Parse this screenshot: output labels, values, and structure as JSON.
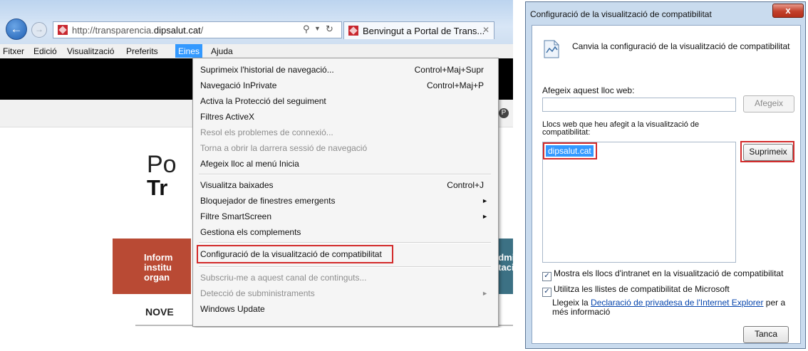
{
  "browser": {
    "address_url_prefix": "http://transparencia.",
    "address_url_domain": "dipsalut.cat",
    "address_url_suffix": "/",
    "tab_title": "Benvingut a Portal de Trans...",
    "menubar": [
      "Fitxer",
      "Edició",
      "Visualització",
      "Preferits",
      "Eines",
      "Ajuda"
    ],
    "active_menu": "Eines"
  },
  "page": {
    "portal_line1": "Po",
    "portal_line2": "Tr",
    "red_block_text": "Inform\ninstitu\norgan",
    "teal_block_text": "admi\nctaci",
    "nove": "NOVE"
  },
  "dropdown": {
    "items": [
      {
        "label": "Suprimeix l'historial de navegació...",
        "shortcut": "Control+Maj+Supr",
        "enabled": true
      },
      {
        "label": "Navegació InPrivate",
        "shortcut": "Control+Maj+P",
        "enabled": true
      },
      {
        "label": "Activa la Protecció del seguiment",
        "shortcut": "",
        "enabled": true
      },
      {
        "label": "Filtres ActiveX",
        "shortcut": "",
        "enabled": true
      },
      {
        "label": "Resol els problemes de connexió...",
        "shortcut": "",
        "enabled": false
      },
      {
        "label": "Torna a obrir la darrera sessió de navegació",
        "shortcut": "",
        "enabled": false
      },
      {
        "label": "Afegeix lloc al menú Inicia",
        "shortcut": "",
        "enabled": true
      },
      {
        "label": "Visualitza baixades",
        "shortcut": "Control+J",
        "enabled": true
      },
      {
        "label": "Bloquejador de finestres emergents",
        "shortcut": "",
        "enabled": true,
        "submenu": true
      },
      {
        "label": "Filtre SmartScreen",
        "shortcut": "",
        "enabled": true,
        "submenu": true
      },
      {
        "label": "Gestiona els complements",
        "shortcut": "",
        "enabled": true
      },
      {
        "label": "Configuració de la visualització de compatibilitat",
        "shortcut": "",
        "enabled": true,
        "highlighted": true
      },
      {
        "label": "Subscriu-me a aquest canal de continguts...",
        "shortcut": "",
        "enabled": false
      },
      {
        "label": "Detecció de subministraments",
        "shortcut": "",
        "enabled": false,
        "submenu": true
      },
      {
        "label": "Windows Update",
        "shortcut": "",
        "enabled": true
      }
    ],
    "submenu_arrow": "►"
  },
  "dialog": {
    "title": "Configuració de la visualització de compatibilitat",
    "close_glyph": "x",
    "heading": "Canvia la configuració de la visualització de compatibilitat",
    "add_label": "Afegeix aquest lloc web:",
    "add_value": "",
    "add_button": "Afegeix",
    "list_label": "Llocs web que heu afegit a la visualització de compatibilitat:",
    "sites": [
      "dipsalut.cat"
    ],
    "remove_button": "Suprimeix",
    "checkbox_intranet": {
      "label": "Mostra els llocs d'intranet en la visualització de compatibilitat",
      "checked": true
    },
    "checkbox_lists": {
      "label": "Utilitza les llistes de compatibilitat de Microsoft",
      "checked": true
    },
    "privacy_before": "Llegeix la ",
    "privacy_link": "Declaració de privadesa de l'Internet Explorer",
    "privacy_after": " per a més informació",
    "close_button": "Tanca"
  },
  "highlight_color": "#d22a2a"
}
